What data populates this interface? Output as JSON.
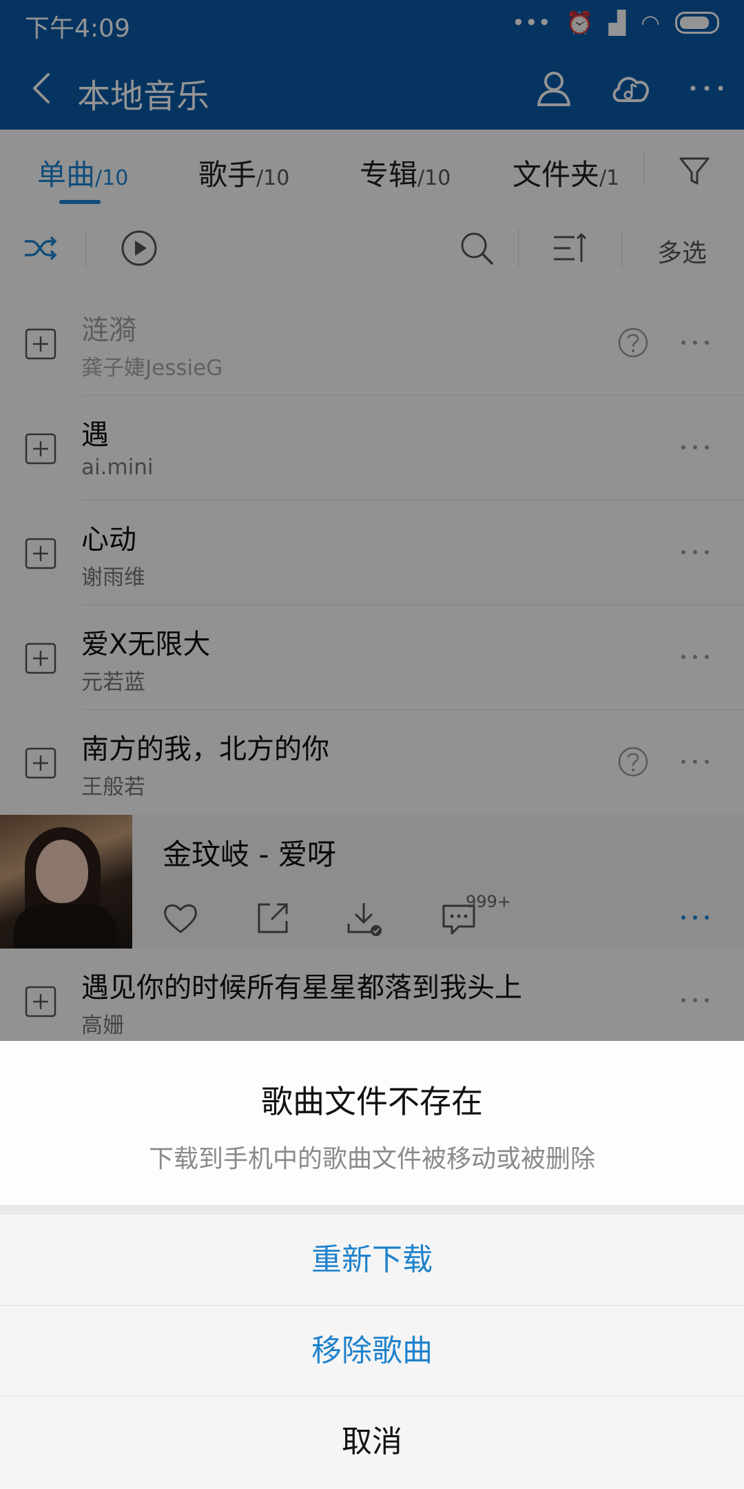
{
  "status_bar": {
    "time": "下午4:09"
  },
  "header": {
    "title": "本地音乐"
  },
  "tabs": [
    {
      "label": "单曲",
      "count": "/10"
    },
    {
      "label": "歌手",
      "count": "/10"
    },
    {
      "label": "专辑",
      "count": "/10"
    },
    {
      "label": "文件夹",
      "count": "/1"
    }
  ],
  "toolbar": {
    "multi_select": "多选"
  },
  "songs": [
    {
      "title": "涟漪",
      "artist": "龚子婕JessieG"
    },
    {
      "title": "遇",
      "artist": "ai.mini"
    },
    {
      "title": "心动",
      "artist": "谢雨维"
    },
    {
      "title": "爱X无限大",
      "artist": "元若蓝"
    },
    {
      "title": "南方的我，北方的你",
      "artist": "王般若"
    },
    {
      "title": "遇见你的时候所有星星都落到我头上",
      "artist": "高姗"
    }
  ],
  "now_playing": {
    "title": "金玟岐 - 爱呀",
    "comment_count": "999+"
  },
  "dialog": {
    "title": "歌曲文件不存在",
    "message": "下载到手机中的歌曲文件被移动或被删除",
    "actions": [
      "重新下载",
      "移除歌曲",
      "取消"
    ]
  },
  "colors": {
    "header": "#0a5aa8",
    "accent": "#1c86d4",
    "action_blue": "#1f82cc"
  }
}
